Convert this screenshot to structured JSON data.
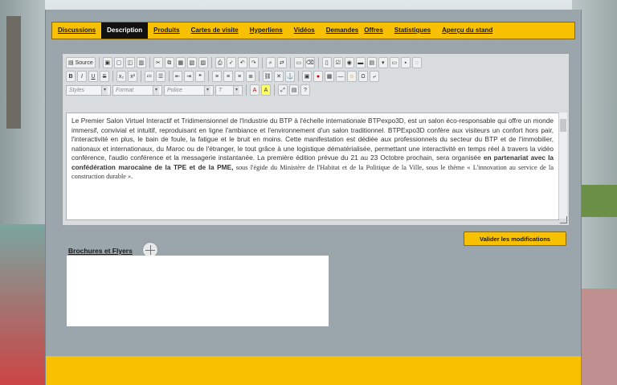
{
  "tabs": [
    {
      "label": "Discussions",
      "active": false
    },
    {
      "label": "Description",
      "active": true
    },
    {
      "label": "Produits",
      "active": false
    },
    {
      "label": "Cartes de visite",
      "active": false
    },
    {
      "label": "Hyperliens",
      "active": false
    },
    {
      "label": "Vidéos",
      "active": false
    },
    {
      "label": "Demandes",
      "active": false
    },
    {
      "label": "Offres",
      "active": false
    },
    {
      "label": "Statistiques",
      "active": false
    },
    {
      "label": "Aperçu du stand",
      "active": false
    }
  ],
  "editor": {
    "source_label": "Source",
    "styles_placeholder": "Styles",
    "format_placeholder": "Format",
    "font_placeholder": "Police",
    "size_placeholder": "T",
    "content_para1": "Le Premier Salon Virtuel Interactif et Tridimensionnel de l'Industrie du BTP à l'échelle internationale BTPexpo3D, est un salon éco-responsable qui offre un monde immersif, convivial et intuitif, reproduisant en ligne l'ambiance et l'environnement d'un salon traditionnel. BTPExpo3D confère aux visiteurs un confort hors pair, l'interactivité en plus, le bain de foule, la fatigue et le bruit en moins. Cette manifestation est dédiée aux professionnels du secteur du BTP et de l'immobilier, nationaux et internationaux, du Maroc ou de l'étranger, le tout grâce à une logistique dématérialisée, permettant une interactivité en temps réel à travers la vidéo conférence, l'audio conférence et la messagerie instantanée. La première édition prévue du 21 au 23 Octobre prochain, sera organisée ",
    "content_bold": "en partenariat avec la confédération marocaine de la TPE et de la PME,",
    "content_serif": " sous l'égide du Ministère de l'Habitat et de la Politique de la Ville, sous le thème « L'innovation au service de la construction durable »."
  },
  "brochures_label": "Brochures et Flyers",
  "validate_label": "Valider les modifications",
  "colors": {
    "accent": "#f7c000",
    "panel": "#9aa6ac"
  },
  "icons": [
    "add-icon",
    "source-icon",
    "save-icon",
    "bold-icon",
    "italic-icon",
    "underline-icon"
  ]
}
